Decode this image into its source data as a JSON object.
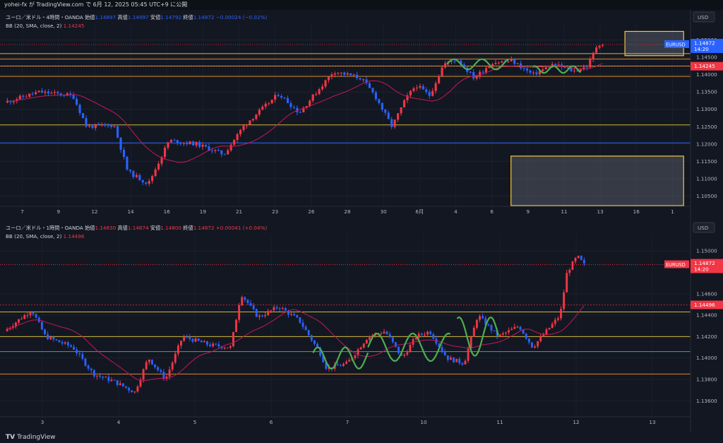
{
  "header": {
    "text": "yohei-fx が TradingView.com で 6月 12, 2025 05:45 UTC+9 に公開"
  },
  "footer": {
    "logo": "TV",
    "brand": "TradingView"
  },
  "colors": {
    "bg": "#131722",
    "up": "#f23645",
    "down": "#2962ff",
    "basis": "#c2185b",
    "zone": "#f5c542",
    "hline_yellow": "#d4b83a",
    "hline_orange": "#d98b2b",
    "hline_blue": "#2962ff",
    "hline_green": "#4caf50",
    "wave": "#4caf50"
  },
  "chart_data": [
    {
      "type": "candlestick",
      "symbol": "ユーロ／米ドル・4時間・OANDA",
      "ohlc": {
        "open_label": "始値",
        "open": "1.14897",
        "high_label": "高値",
        "high": "1.14997",
        "low_label": "安値",
        "low": "1.14792",
        "close_label": "終値",
        "close": "1.14872",
        "change": "−0.00024 (−0.02%)"
      },
      "indicator": {
        "label": "BB (20, SMA, close, 2)",
        "value": "1.14245"
      },
      "currency": "USD",
      "ticker": "EURUSD",
      "price_tag": {
        "value": "1.14872",
        "timer": "14:20"
      },
      "basis_tag": "1.14245",
      "ylim": [
        1.102,
        1.153
      ],
      "y_ticks": [
        "1.15000",
        "1.14500",
        "1.14000",
        "1.13500",
        "1.13000",
        "1.12500",
        "1.12000",
        "1.11500",
        "1.11000",
        "1.10500"
      ],
      "x_ticks": [
        "7",
        "9",
        "12",
        "14",
        "16",
        "19",
        "21",
        "23",
        "26",
        "28",
        "30",
        "6月",
        "4",
        "6",
        "9",
        "11",
        "13",
        "16",
        "1"
      ],
      "hlines": [
        {
          "y": 1.1461,
          "color": "yellow"
        },
        {
          "y": 1.1445,
          "color": "orange"
        },
        {
          "y": 1.1425,
          "color": "yellow"
        },
        {
          "y": 1.1395,
          "color": "orange"
        },
        {
          "y": 1.1255,
          "color": "yellow"
        },
        {
          "y": 1.1203,
          "color": "blue"
        }
      ],
      "zones": [
        {
          "x_start": 0.905,
          "x_end": 0.99,
          "y_low": 1.1455,
          "y_high": 1.1525
        },
        {
          "x_start": 0.74,
          "x_end": 0.99,
          "y_low": 1.1022,
          "y_high": 1.1165
        }
      ],
      "anchors": [
        {
          "t": 0.0,
          "v": 1.132
        },
        {
          "t": 0.05,
          "v": 1.135
        },
        {
          "t": 0.1,
          "v": 1.134
        },
        {
          "t": 0.12,
          "v": 1.125
        },
        {
          "t": 0.16,
          "v": 1.1255
        },
        {
          "t": 0.18,
          "v": 1.112
        },
        {
          "t": 0.21,
          "v": 1.1085
        },
        {
          "t": 0.24,
          "v": 1.121
        },
        {
          "t": 0.28,
          "v": 1.12
        },
        {
          "t": 0.32,
          "v": 1.117
        },
        {
          "t": 0.35,
          "v": 1.1255
        },
        {
          "t": 0.4,
          "v": 1.1345
        },
        {
          "t": 0.43,
          "v": 1.129
        },
        {
          "t": 0.48,
          "v": 1.141
        },
        {
          "t": 0.52,
          "v": 1.139
        },
        {
          "t": 0.54,
          "v": 1.134
        },
        {
          "t": 0.565,
          "v": 1.125
        },
        {
          "t": 0.585,
          "v": 1.133
        },
        {
          "t": 0.6,
          "v": 1.137
        },
        {
          "t": 0.62,
          "v": 1.134
        },
        {
          "t": 0.64,
          "v": 1.143
        },
        {
          "t": 0.66,
          "v": 1.1445
        },
        {
          "t": 0.685,
          "v": 1.139
        },
        {
          "t": 0.71,
          "v": 1.1435
        },
        {
          "t": 0.74,
          "v": 1.144
        },
        {
          "t": 0.77,
          "v": 1.14
        },
        {
          "t": 0.8,
          "v": 1.143
        },
        {
          "t": 0.83,
          "v": 1.141
        },
        {
          "t": 0.85,
          "v": 1.1425
        },
        {
          "t": 0.865,
          "v": 1.149
        },
        {
          "t": 0.872,
          "v": 1.1487
        }
      ]
    },
    {
      "type": "candlestick",
      "symbol": "ユーロ／米ドル・1時間・OANDA",
      "ohlc": {
        "open_label": "始値",
        "open": "1.14830",
        "high_label": "高値",
        "high": "1.14874",
        "low_label": "安値",
        "low": "1.14800",
        "close_label": "終値",
        "close": "1.14872",
        "change": "+0.00041 (+0.04%)"
      },
      "indicator": {
        "label": "BB (20, SMA, close, 2)",
        "value": "1.14496"
      },
      "currency": "USD",
      "ticker": "EURUSD",
      "price_tag": {
        "value": "1.14872",
        "timer": "14:20"
      },
      "basis_tag": "1.14496",
      "ylim": [
        1.1345,
        1.151
      ],
      "y_ticks": [
        "1.15000",
        "1.14600",
        "1.14400",
        "1.14200",
        "1.14000",
        "1.13800",
        "1.13600"
      ],
      "x_ticks": [
        "3",
        "4",
        "5",
        "6",
        "7",
        "10",
        "11",
        "12",
        "13"
      ],
      "hlines": [
        {
          "y": 1.1443,
          "color": "yellow"
        },
        {
          "y": 1.142,
          "color": "yellow"
        },
        {
          "y": 1.1406,
          "color": "green"
        },
        {
          "y": 1.1385,
          "color": "orange"
        }
      ],
      "anchors": [
        {
          "t": 0.0,
          "v": 1.1425
        },
        {
          "t": 0.04,
          "v": 1.1445
        },
        {
          "t": 0.06,
          "v": 1.142
        },
        {
          "t": 0.1,
          "v": 1.141
        },
        {
          "t": 0.13,
          "v": 1.1385
        },
        {
          "t": 0.16,
          "v": 1.1378
        },
        {
          "t": 0.19,
          "v": 1.1368
        },
        {
          "t": 0.21,
          "v": 1.14
        },
        {
          "t": 0.235,
          "v": 1.138
        },
        {
          "t": 0.26,
          "v": 1.142
        },
        {
          "t": 0.3,
          "v": 1.1412
        },
        {
          "t": 0.33,
          "v": 1.141
        },
        {
          "t": 0.345,
          "v": 1.146
        },
        {
          "t": 0.37,
          "v": 1.1438
        },
        {
          "t": 0.4,
          "v": 1.1448
        },
        {
          "t": 0.43,
          "v": 1.1435
        },
        {
          "t": 0.46,
          "v": 1.1405
        },
        {
          "t": 0.47,
          "v": 1.139
        },
        {
          "t": 0.5,
          "v": 1.1395
        },
        {
          "t": 0.53,
          "v": 1.142
        },
        {
          "t": 0.555,
          "v": 1.1425
        },
        {
          "t": 0.58,
          "v": 1.14
        },
        {
          "t": 0.6,
          "v": 1.142
        },
        {
          "t": 0.62,
          "v": 1.1425
        },
        {
          "t": 0.645,
          "v": 1.14
        },
        {
          "t": 0.67,
          "v": 1.1395
        },
        {
          "t": 0.69,
          "v": 1.144
        },
        {
          "t": 0.72,
          "v": 1.142
        },
        {
          "t": 0.75,
          "v": 1.143
        },
        {
          "t": 0.77,
          "v": 1.141
        },
        {
          "t": 0.79,
          "v": 1.1425
        },
        {
          "t": 0.81,
          "v": 1.144
        },
        {
          "t": 0.82,
          "v": 1.148
        },
        {
          "t": 0.835,
          "v": 1.1495
        },
        {
          "t": 0.845,
          "v": 1.1487
        }
      ]
    }
  ]
}
